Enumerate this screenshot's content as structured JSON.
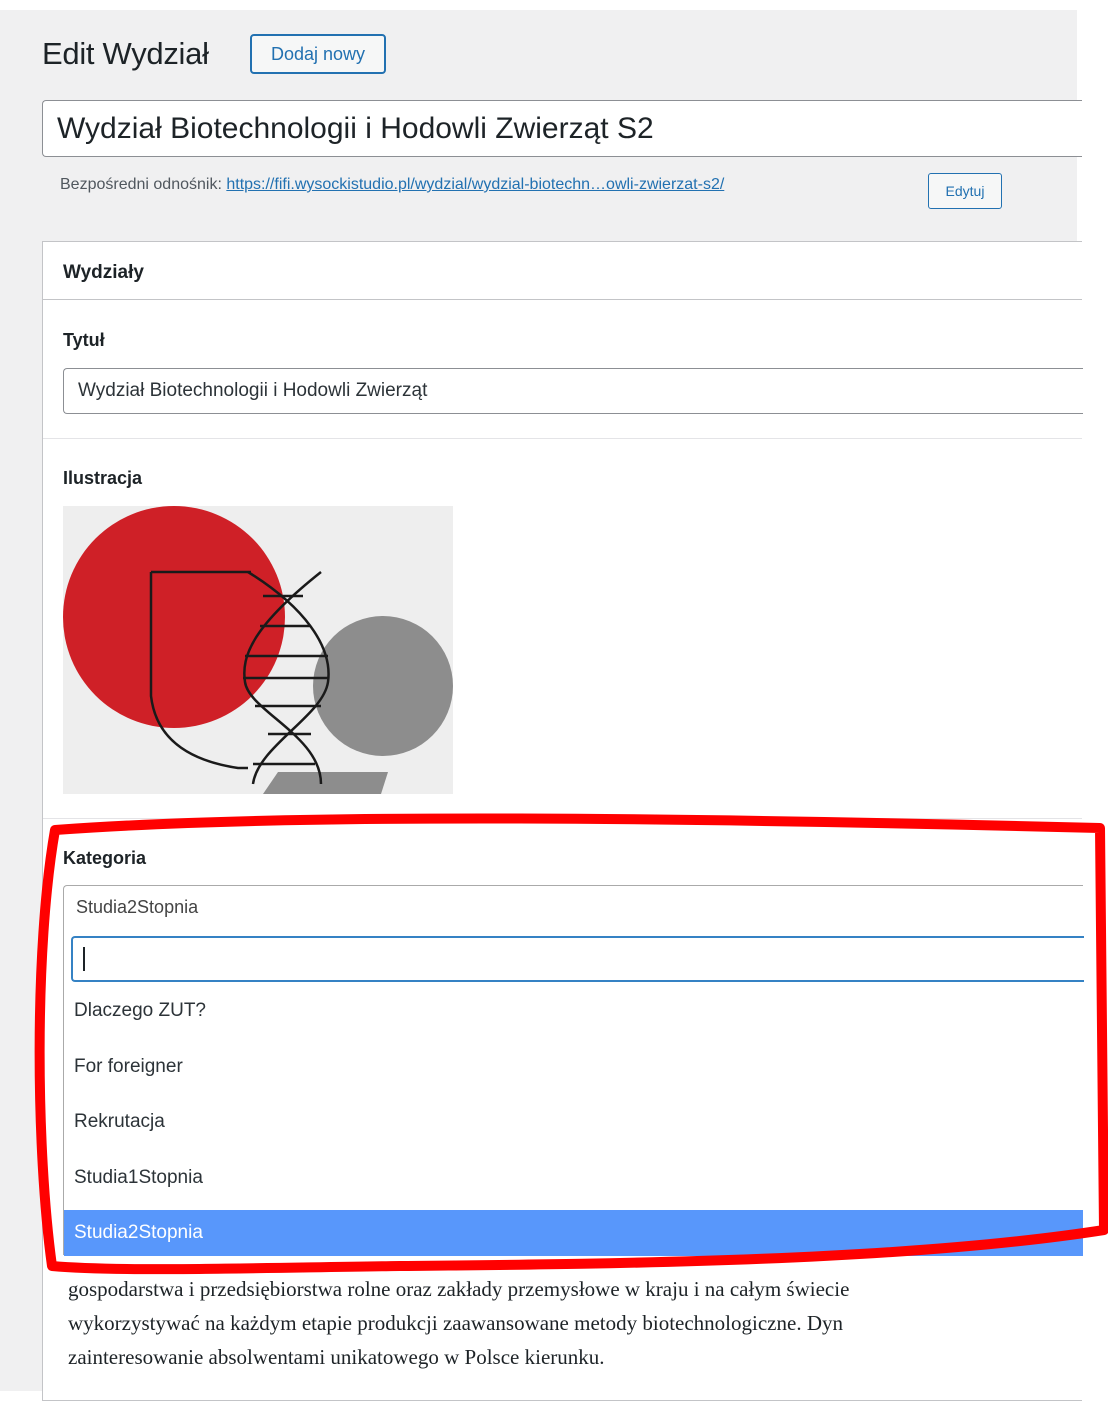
{
  "header": {
    "title": "Edit Wydział",
    "add_new_label": "Dodaj nowy"
  },
  "post": {
    "title_value": "Wydział Biotechnologii i Hodowli Zwierząt S2",
    "permalink_label": "Bezpośredni odnośnik:",
    "permalink_url": "https://fifi.wysockistudio.pl/wydzial/wydzial-biotechn…owli-zwierzat-s2/",
    "permalink_edit_label": "Edytuj"
  },
  "metabox": {
    "title": "Wydziały",
    "fields": {
      "tytul_label": "Tytuł",
      "tytul_value": "Wydział Biotechnologii i Hodowli Zwierząt",
      "ilustracja_label": "Ilustracja",
      "kategoria_label": "Kategoria",
      "kategoria_value": "Studia2Stopnia",
      "search_value": ""
    },
    "category_options": [
      "Dlaczego ZUT?",
      "For foreigner",
      "Rekrutacja",
      "Studia1Stopnia",
      "Studia2Stopnia"
    ],
    "selected_option": "Studia2Stopnia"
  },
  "editor": {
    "lines": [
      "gospodarstwa i przedsiębiorstwa rolne oraz zakłady przemysłowe w kraju i na całym świecie",
      "wykorzystywać na każdym etapie produkcji zaawansowane metody biotechnologiczne. Dyn",
      "zainteresowanie absolwentami unikatowego w Polsce kierunku."
    ]
  },
  "colors": {
    "accent": "#2271b1",
    "selected_option_bg": "#5897fb",
    "annotation": "#ff0000",
    "illustration_red": "#cf2027",
    "illustration_gray": "#8d8d8d"
  }
}
